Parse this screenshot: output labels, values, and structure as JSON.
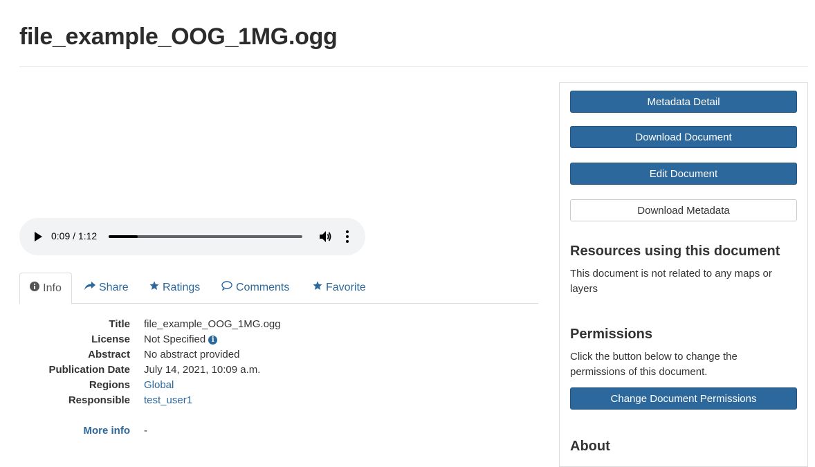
{
  "page": {
    "title": "file_example_OOG_1MG.ogg"
  },
  "audio": {
    "time": "0:09 / 1:12",
    "progress_fraction": 0.15
  },
  "tabs": [
    {
      "label": "Info",
      "icon": "info-circle-icon"
    },
    {
      "label": "Share",
      "icon": "share-icon"
    },
    {
      "label": "Ratings",
      "icon": "star-icon"
    },
    {
      "label": "Comments",
      "icon": "comment-icon"
    },
    {
      "label": "Favorite",
      "icon": "star-icon"
    }
  ],
  "info": {
    "title_label": "Title",
    "title_value": "file_example_OOG_1MG.ogg",
    "license_label": "License",
    "license_value": "Not Specified",
    "abstract_label": "Abstract",
    "abstract_value": "No abstract provided",
    "pubdate_label": "Publication Date",
    "pubdate_value": "July 14, 2021, 10:09 a.m.",
    "regions_label": "Regions",
    "regions_value": "Global",
    "responsible_label": "Responsible",
    "responsible_value": "test_user1",
    "more_info_label": "More info",
    "more_info_value": "-"
  },
  "sidebar": {
    "metadata_detail": "Metadata Detail",
    "download_document": "Download Document",
    "edit_document": "Edit Document",
    "download_metadata": "Download Metadata",
    "resources_heading": "Resources using this document",
    "resources_text": "This document is not related to any maps or layers",
    "permissions_heading": "Permissions",
    "permissions_text": "Click the button below to change the permissions of this document.",
    "change_permissions": "Change Document Permissions",
    "about_heading": "About"
  },
  "colors": {
    "primary": "#2c689c",
    "link": "#2c689c",
    "text": "#333333",
    "border": "#dddddd",
    "audio_bg": "#f1f3f4"
  }
}
